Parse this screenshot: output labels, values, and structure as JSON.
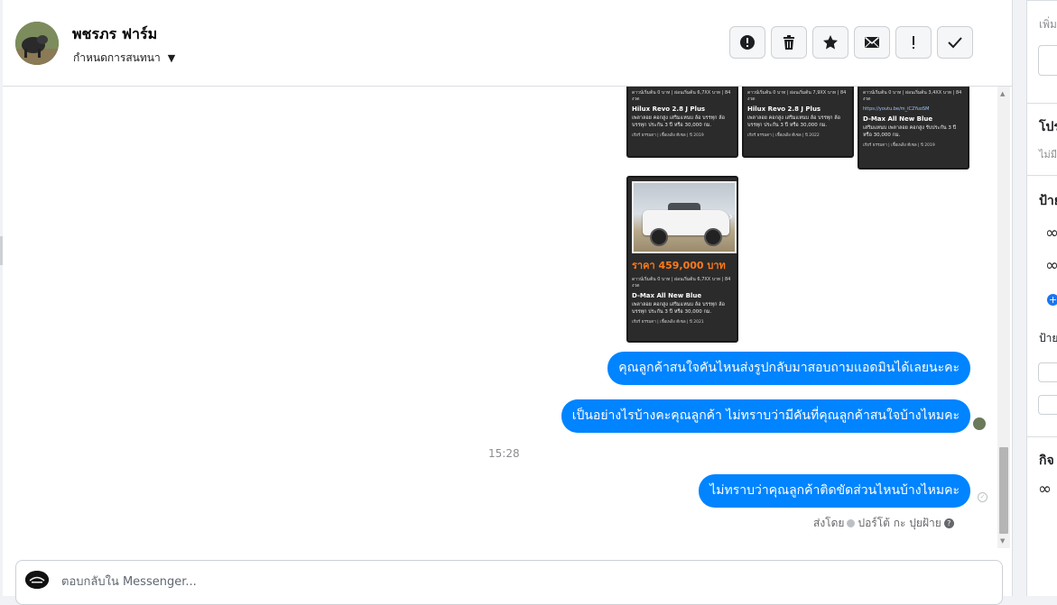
{
  "header": {
    "contact_name": "พชรภร ฟาร์ม",
    "assign_label": "กำหนดการสนทนา"
  },
  "actions": [
    {
      "name": "spam-button",
      "icon": "alert-circle-icon"
    },
    {
      "name": "delete-button",
      "icon": "trash-icon"
    },
    {
      "name": "star-button",
      "icon": "star-icon"
    },
    {
      "name": "mark-unread-button",
      "icon": "envelope-icon"
    },
    {
      "name": "follow-up-button",
      "icon": "exclamation-icon"
    },
    {
      "name": "mark-done-button",
      "icon": "checkmark-icon"
    }
  ],
  "cards": [
    {
      "specs": "ดาวน์เริ่มต้น 0 บาท | ผ่อนเริ่มต้น 6,7XX บาท | 84 งวด",
      "title": "Hilux Revo 2.8 J Plus",
      "desc": "เพลาลอย คอกสูง เสริมแหนบ ล้อ บรรทุก ล้อบรรทุก ประกัน 3 ปี หรือ 30,000 กม.",
      "footer": "เกียร์ ธรรมดา | เชื้อเพลิง ดีเซล | ปี 2019"
    },
    {
      "specs": "ดาวน์เริ่มต้น 0 บาท | ผ่อนเริ่มต้น 7,9XX บาท | 84 งวด",
      "title": "Hilux Revo 2.8 J Plus",
      "desc": "เพลาลอย คอกสูง เสริมแหนบ ล้อ บรรทุก ล้อบรรทุก ประกัน 3 ปี หรือ 30,000 กม.",
      "footer": "เกียร์ ธรรมดา | เชื้อเพลิง ดีเซล | ปี 2022"
    },
    {
      "specs": "ดาวน์เริ่มต้น 0 บาท | ผ่อนเริ่มต้น 3,4XX บาท | 84 งวด",
      "link": "https://youtu.be/m_iC2YuoSM",
      "title": "D-Max All New Blue",
      "desc": "เสริมแหนบ เพลาลอย คอกสูง รับประกัน 3 ปี หรือ 30,000 กม.",
      "footer": "เกียร์ ธรรมดา | เชื้อเพลิง ดีเซล | ปี 2019"
    },
    {
      "price": "ราคา 459,000 บาท",
      "specs": "ดาวน์เริ่มต้น 0 บาท | ผ่อนเริ่มต้น 6,7XX บาท | 84 งวด",
      "title": "D-Max All New Blue",
      "desc": "เพลาลอย คอกสูง เสริมแหนบ ล้อ บรรทุก ล้อบรรทุก ประกัน 3 ปี หรือ 30,000 กม.",
      "footer": "เกียร์ ธรรมดา | เชื้อเพลิง ดีเซล | ปี 2021"
    }
  ],
  "messages": [
    {
      "text": "คุณลูกค้าสนใจคันไหนส่งรูปกลับมาสอบถามแอดมินได้เลยนะคะ"
    },
    {
      "text": "เป็นอย่างไรบ้างคะคุณลูกค้า ไม่ทราบว่ามีคันที่คุณลูกค้าสนใจบ้างไหมคะ"
    },
    {
      "text": "ไม่ทราบว่าคุณลูกค้าติดขัดส่วนไหนบ้างไหมคะ"
    }
  ],
  "timestamp": "15:28",
  "sent_by": {
    "prefix": "ส่งโดย",
    "name": "ปอร์โต้ กะ ปุยฝ้าย"
  },
  "composer": {
    "placeholder": "ตอบกลับใน Messenger..."
  },
  "right_panel": {
    "line1": "เพิ่ม",
    "heading2": "โปร",
    "line2": "ไม่มี",
    "heading3": "ป้าย",
    "heading4": "ป้าย",
    "heading5": "กิจ"
  },
  "colors": {
    "bubble": "#0084ff",
    "price": "#ff7a1a"
  }
}
